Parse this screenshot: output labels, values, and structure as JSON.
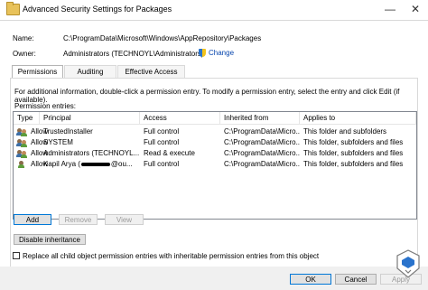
{
  "window": {
    "title": "Advanced Security Settings for Packages",
    "minimize_glyph": "—",
    "close_glyph": "✕"
  },
  "header": {
    "name_label": "Name:",
    "name_value": "C:\\ProgramData\\Microsoft\\Windows\\AppRepository\\Packages",
    "owner_label": "Owner:",
    "owner_value": "Administrators (TECHNOYL\\Administrators)",
    "change_link": "Change"
  },
  "tabs": [
    {
      "label": "Permissions",
      "active": true
    },
    {
      "label": "Auditing",
      "active": false
    },
    {
      "label": "Effective Access",
      "active": false
    }
  ],
  "permissions": {
    "info_text": "For additional information, double-click a permission entry. To modify a permission entry, select the entry and click Edit (if available).",
    "entries_label": "Permission entries:",
    "columns": [
      "Type",
      "Principal",
      "Access",
      "Inherited from",
      "Applies to"
    ],
    "rows": [
      {
        "type": "Allow",
        "principal": "TrustedInstaller",
        "access": "Full control",
        "inherited": "C:\\ProgramData\\Micro...",
        "applies": "This folder and subfolders"
      },
      {
        "type": "Allow",
        "principal": "SYSTEM",
        "access": "Full control",
        "inherited": "C:\\ProgramData\\Micro...",
        "applies": "This folder, subfolders and files"
      },
      {
        "type": "Allow",
        "principal": "Administrators (TECHNOYL...",
        "access": "Read & execute",
        "inherited": "C:\\ProgramData\\Micro...",
        "applies": "This folder, subfolders and files"
      },
      {
        "type": "Allow",
        "principal_start": "Kapil Arya (",
        "principal_end": "@ou...",
        "access": "Full control",
        "inherited": "C:\\ProgramData\\Micro...",
        "applies": "This folder, subfolders and files"
      }
    ]
  },
  "buttons": {
    "add": "Add",
    "remove": "Remove",
    "view": "View",
    "disable_inheritance": "Disable inheritance",
    "ok": "OK",
    "cancel": "Cancel",
    "apply": "Apply"
  },
  "replace_checkbox": {
    "label": "Replace all child object permission entries with inheritable permission entries from this object",
    "checked": false
  },
  "colors": {
    "link": "#0645ad",
    "focus_border": "#0078d7"
  },
  "icons": [
    "folder-icon",
    "shield-icon",
    "users-icon",
    "watermark-logo"
  ]
}
